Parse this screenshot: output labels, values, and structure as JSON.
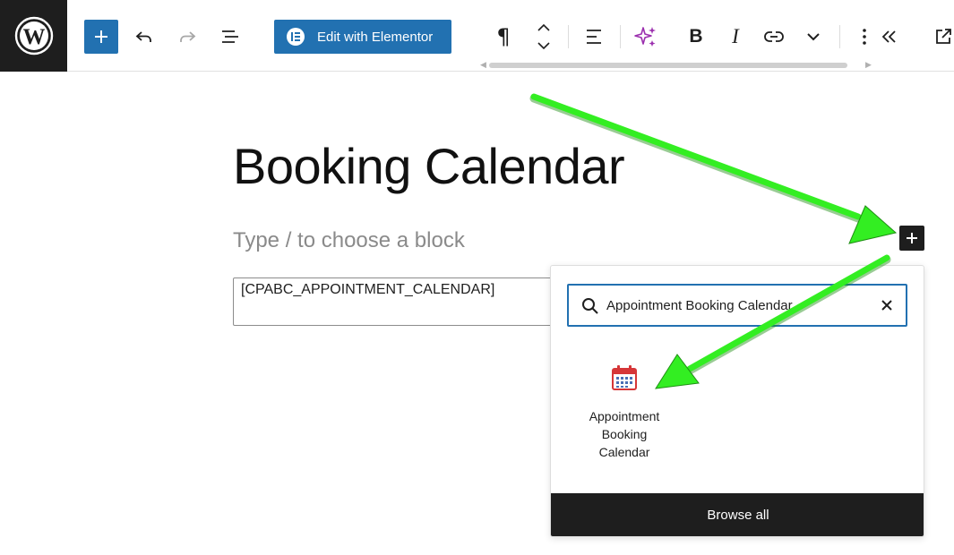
{
  "toolbar": {
    "elementor_label": "Edit with Elementor",
    "bold_glyph": "B",
    "italic_glyph": "I",
    "paragraph_glyph": "¶",
    "icons": [
      "wordpress-logo",
      "plus-icon",
      "undo-icon",
      "redo-icon",
      "list-view-icon",
      "elementor-icon",
      "paragraph-icon",
      "move-updown-icon",
      "align-icon",
      "ai-sparkle-icon",
      "link-icon",
      "chevron-down-icon",
      "more-vertical-icon",
      "collapse-icon",
      "external-link-icon"
    ]
  },
  "editor": {
    "title": "Booking Calendar",
    "placeholder": "Type / to choose a block",
    "shortcode": "[CPABC_APPOINTMENT_CALENDAR]"
  },
  "inserter": {
    "search_value": "Appointment Booking Calendar",
    "results": [
      {
        "label": "Appointment Booking Calendar",
        "icon": "calendar-icon"
      }
    ],
    "browse_all": "Browse all"
  },
  "colors": {
    "primary": "#2271b1",
    "dark": "#1e1e1e",
    "annotation": "#33ee22",
    "ai": "#9b2fae",
    "calendar": "#d63638"
  }
}
